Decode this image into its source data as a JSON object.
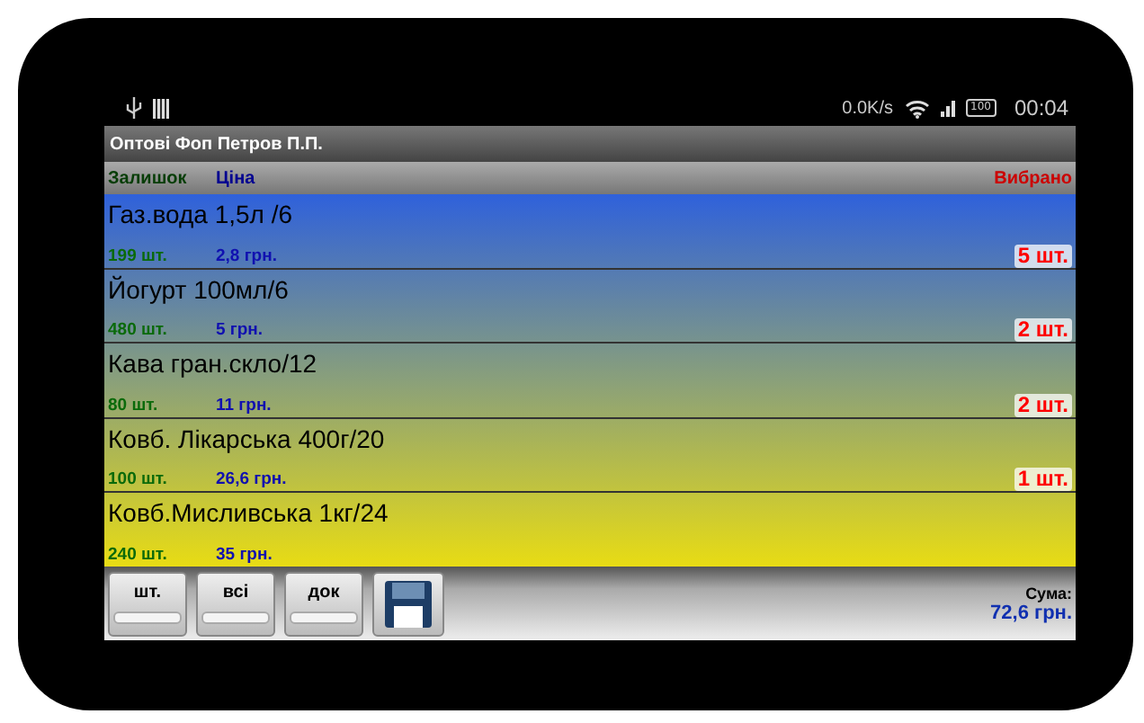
{
  "status_bar": {
    "speed": "0.0K/s",
    "battery": "100",
    "time": "00:04"
  },
  "window": {
    "title": "Оптові Фоп Петров П.П."
  },
  "columns": {
    "stock": "Залишок",
    "price": "Ціна",
    "picked": "Вибрано"
  },
  "items": [
    {
      "name": "Газ.вода 1,5л /6",
      "stock": "199 шт.",
      "price": "2,8 грн.",
      "picked": "5 шт."
    },
    {
      "name": "Йогурт 100мл/6",
      "stock": "480 шт.",
      "price": "5 грн.",
      "picked": "2 шт."
    },
    {
      "name": "Кава гран.скло/12",
      "stock": "80 шт.",
      "price": "11 грн.",
      "picked": "2 шт."
    },
    {
      "name": "Ковб. Лікарська 400г/20",
      "stock": "100 шт.",
      "price": "26,6 грн.",
      "picked": "1 шт."
    },
    {
      "name": "Ковб.Мисливська 1кг/24",
      "stock": "240 шт.",
      "price": "35 грн."
    }
  ],
  "buttons": [
    "шт.",
    "всі",
    "док"
  ],
  "total": {
    "label": "Сума:",
    "value": "72,6 грн."
  }
}
